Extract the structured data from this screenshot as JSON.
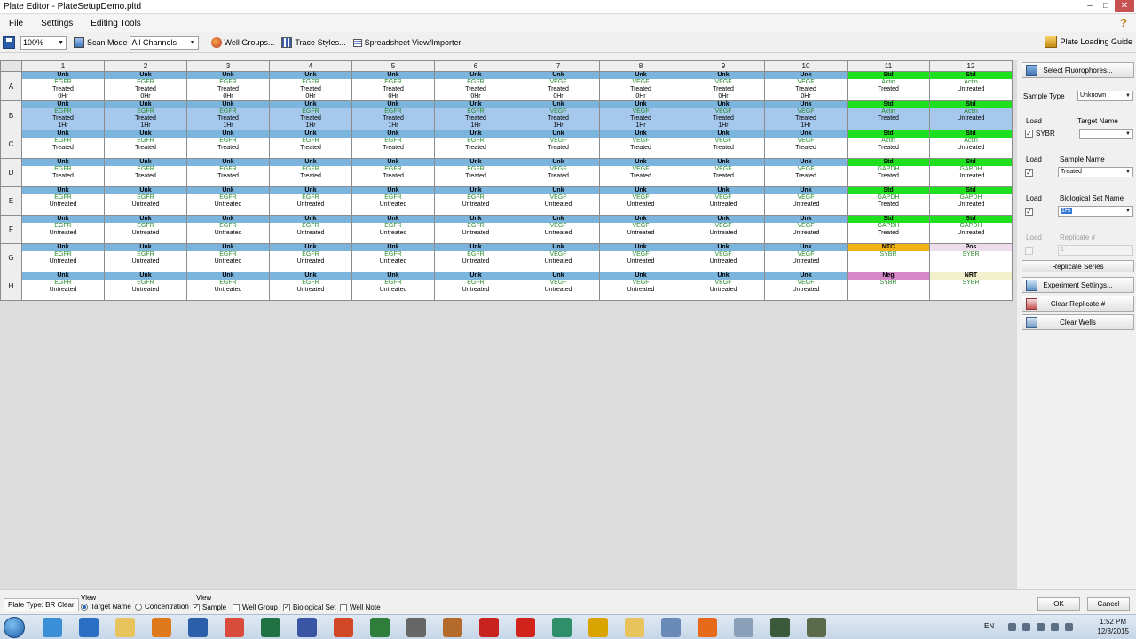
{
  "window": {
    "title": "Plate Editor - PlateSetupDemo.pltd"
  },
  "menu": [
    "File",
    "Settings",
    "Editing Tools"
  ],
  "toolbar": {
    "zoom": "100%",
    "scan_mode_label": "Scan Mode",
    "scan_mode_value": "All Channels",
    "well_groups": "Well Groups...",
    "trace_styles": "Trace Styles...",
    "spreadsheet": "Spreadsheet View/Importer",
    "plate_guide": "Plate Loading Guide"
  },
  "plate": {
    "columns": [
      "1",
      "2",
      "3",
      "4",
      "5",
      "6",
      "7",
      "8",
      "9",
      "10",
      "11",
      "12"
    ],
    "rows": [
      {
        "label": "A",
        "selected": false,
        "wells": [
          {
            "type": "Unk",
            "target": "EGFR",
            "lines": [
              "Treated",
              "0Hr"
            ]
          },
          {
            "type": "Unk",
            "target": "EGFR",
            "lines": [
              "Treated",
              "0Hr"
            ]
          },
          {
            "type": "Unk",
            "target": "EGFR",
            "lines": [
              "Treated",
              "0Hr"
            ]
          },
          {
            "type": "Unk",
            "target": "EGFR",
            "lines": [
              "Treated",
              "0Hr"
            ]
          },
          {
            "type": "Unk",
            "target": "EGFR",
            "lines": [
              "Treated",
              "0Hr"
            ]
          },
          {
            "type": "Unk",
            "target": "EGFR",
            "lines": [
              "Treated",
              "0Hr"
            ]
          },
          {
            "type": "Unk",
            "target": "VEGF",
            "lines": [
              "Treated",
              "0Hr"
            ]
          },
          {
            "type": "Unk",
            "target": "VEGF",
            "lines": [
              "Treated",
              "0Hr"
            ]
          },
          {
            "type": "Unk",
            "target": "VEGF",
            "lines": [
              "Treated",
              "0Hr"
            ]
          },
          {
            "type": "Unk",
            "target": "VEGF",
            "lines": [
              "Treated",
              "0Hr"
            ]
          },
          {
            "type": "Std",
            "target": "Actin",
            "lines": [
              "Treated"
            ]
          },
          {
            "type": "Std",
            "target": "Actin",
            "lines": [
              "Untreated"
            ]
          }
        ]
      },
      {
        "label": "B",
        "selected": true,
        "wells": [
          {
            "type": "Unk",
            "target": "EGFR",
            "lines": [
              "Treated",
              "1Hr"
            ]
          },
          {
            "type": "Unk",
            "target": "EGFR",
            "lines": [
              "Treated",
              "1Hr"
            ]
          },
          {
            "type": "Unk",
            "target": "EGFR",
            "lines": [
              "Treated",
              "1Hr"
            ]
          },
          {
            "type": "Unk",
            "target": "EGFR",
            "lines": [
              "Treated",
              "1Hr"
            ]
          },
          {
            "type": "Unk",
            "target": "EGFR",
            "lines": [
              "Treated",
              "1Hr"
            ]
          },
          {
            "type": "Unk",
            "target": "EGFR",
            "lines": [
              "Treated",
              "1Hr"
            ]
          },
          {
            "type": "Unk",
            "target": "VEGF",
            "lines": [
              "Treated",
              "1Hr"
            ]
          },
          {
            "type": "Unk",
            "target": "VEGF",
            "lines": [
              "Treated",
              "1Hr"
            ]
          },
          {
            "type": "Unk",
            "target": "VEGF",
            "lines": [
              "Treated",
              "1Hr"
            ]
          },
          {
            "type": "Unk",
            "target": "VEGF",
            "lines": [
              "Treated",
              "1Hr"
            ]
          },
          {
            "type": "Std",
            "target": "Actin",
            "lines": [
              "Treated"
            ]
          },
          {
            "type": "Std",
            "target": "Actin",
            "lines": [
              "Untreated"
            ]
          }
        ]
      },
      {
        "label": "C",
        "selected": false,
        "wells": [
          {
            "type": "Unk",
            "target": "EGFR",
            "lines": [
              "Treated"
            ]
          },
          {
            "type": "Unk",
            "target": "EGFR",
            "lines": [
              "Treated"
            ]
          },
          {
            "type": "Unk",
            "target": "EGFR",
            "lines": [
              "Treated"
            ]
          },
          {
            "type": "Unk",
            "target": "EGFR",
            "lines": [
              "Treated"
            ]
          },
          {
            "type": "Unk",
            "target": "EGFR",
            "lines": [
              "Treated"
            ]
          },
          {
            "type": "Unk",
            "target": "EGFR",
            "lines": [
              "Treated"
            ]
          },
          {
            "type": "Unk",
            "target": "VEGF",
            "lines": [
              "Treated"
            ]
          },
          {
            "type": "Unk",
            "target": "VEGF",
            "lines": [
              "Treated"
            ]
          },
          {
            "type": "Unk",
            "target": "VEGF",
            "lines": [
              "Treated"
            ]
          },
          {
            "type": "Unk",
            "target": "VEGF",
            "lines": [
              "Treated"
            ]
          },
          {
            "type": "Std",
            "target": "Actin",
            "lines": [
              "Treated"
            ]
          },
          {
            "type": "Std",
            "target": "Actin",
            "lines": [
              "Untreated"
            ]
          }
        ]
      },
      {
        "label": "D",
        "selected": false,
        "wells": [
          {
            "type": "Unk",
            "target": "EGFR",
            "lines": [
              "Treated"
            ]
          },
          {
            "type": "Unk",
            "target": "EGFR",
            "lines": [
              "Treated"
            ]
          },
          {
            "type": "Unk",
            "target": "EGFR",
            "lines": [
              "Treated"
            ]
          },
          {
            "type": "Unk",
            "target": "EGFR",
            "lines": [
              "Treated"
            ]
          },
          {
            "type": "Unk",
            "target": "EGFR",
            "lines": [
              "Treated"
            ]
          },
          {
            "type": "Unk",
            "target": "EGFR",
            "lines": [
              "Treated"
            ]
          },
          {
            "type": "Unk",
            "target": "VEGF",
            "lines": [
              "Treated"
            ]
          },
          {
            "type": "Unk",
            "target": "VEGF",
            "lines": [
              "Treated"
            ]
          },
          {
            "type": "Unk",
            "target": "VEGF",
            "lines": [
              "Treated"
            ]
          },
          {
            "type": "Unk",
            "target": "VEGF",
            "lines": [
              "Treated"
            ]
          },
          {
            "type": "Std",
            "target": "GAPDH",
            "lines": [
              "Treated"
            ]
          },
          {
            "type": "Std",
            "target": "GAPDH",
            "lines": [
              "Untreated"
            ]
          }
        ]
      },
      {
        "label": "E",
        "selected": false,
        "wells": [
          {
            "type": "Unk",
            "target": "EGFR",
            "lines": [
              "Untreated"
            ]
          },
          {
            "type": "Unk",
            "target": "EGFR",
            "lines": [
              "Untreated"
            ]
          },
          {
            "type": "Unk",
            "target": "EGFR",
            "lines": [
              "Untreated"
            ]
          },
          {
            "type": "Unk",
            "target": "EGFR",
            "lines": [
              "Untreated"
            ]
          },
          {
            "type": "Unk",
            "target": "EGFR",
            "lines": [
              "Untreated"
            ]
          },
          {
            "type": "Unk",
            "target": "EGFR",
            "lines": [
              "Untreated"
            ]
          },
          {
            "type": "Unk",
            "target": "VEGF",
            "lines": [
              "Untreated"
            ]
          },
          {
            "type": "Unk",
            "target": "VEGF",
            "lines": [
              "Untreated"
            ]
          },
          {
            "type": "Unk",
            "target": "VEGF",
            "lines": [
              "Untreated"
            ]
          },
          {
            "type": "Unk",
            "target": "VEGF",
            "lines": [
              "Untreated"
            ]
          },
          {
            "type": "Std",
            "target": "GAPDH",
            "lines": [
              "Treated"
            ]
          },
          {
            "type": "Std",
            "target": "GAPDH",
            "lines": [
              "Untreated"
            ]
          }
        ]
      },
      {
        "label": "F",
        "selected": false,
        "wells": [
          {
            "type": "Unk",
            "target": "EGFR",
            "lines": [
              "Untreated"
            ]
          },
          {
            "type": "Unk",
            "target": "EGFR",
            "lines": [
              "Untreated"
            ]
          },
          {
            "type": "Unk",
            "target": "EGFR",
            "lines": [
              "Untreated"
            ]
          },
          {
            "type": "Unk",
            "target": "EGFR",
            "lines": [
              "Untreated"
            ]
          },
          {
            "type": "Unk",
            "target": "EGFR",
            "lines": [
              "Untreated"
            ]
          },
          {
            "type": "Unk",
            "target": "EGFR",
            "lines": [
              "Untreated"
            ]
          },
          {
            "type": "Unk",
            "target": "VEGF",
            "lines": [
              "Untreated"
            ]
          },
          {
            "type": "Unk",
            "target": "VEGF",
            "lines": [
              "Untreated"
            ]
          },
          {
            "type": "Unk",
            "target": "VEGF",
            "lines": [
              "Untreated"
            ]
          },
          {
            "type": "Unk",
            "target": "VEGF",
            "lines": [
              "Untreated"
            ]
          },
          {
            "type": "Std",
            "target": "GAPDH",
            "lines": [
              "Treated"
            ]
          },
          {
            "type": "Std",
            "target": "GAPDH",
            "lines": [
              "Untreated"
            ]
          }
        ]
      },
      {
        "label": "G",
        "selected": false,
        "wells": [
          {
            "type": "Unk",
            "target": "EGFR",
            "lines": [
              "Untreated"
            ]
          },
          {
            "type": "Unk",
            "target": "EGFR",
            "lines": [
              "Untreated"
            ]
          },
          {
            "type": "Unk",
            "target": "EGFR",
            "lines": [
              "Untreated"
            ]
          },
          {
            "type": "Unk",
            "target": "EGFR",
            "lines": [
              "Untreated"
            ]
          },
          {
            "type": "Unk",
            "target": "EGFR",
            "lines": [
              "Untreated"
            ]
          },
          {
            "type": "Unk",
            "target": "EGFR",
            "lines": [
              "Untreated"
            ]
          },
          {
            "type": "Unk",
            "target": "VEGF",
            "lines": [
              "Untreated"
            ]
          },
          {
            "type": "Unk",
            "target": "VEGF",
            "lines": [
              "Untreated"
            ]
          },
          {
            "type": "Unk",
            "target": "VEGF",
            "lines": [
              "Untreated"
            ]
          },
          {
            "type": "Unk",
            "target": "VEGF",
            "lines": [
              "Untreated"
            ]
          },
          {
            "type": "NTC",
            "target": "SYBR",
            "lines": []
          },
          {
            "type": "Pos",
            "target": "SYBR",
            "lines": []
          }
        ]
      },
      {
        "label": "H",
        "selected": false,
        "wells": [
          {
            "type": "Unk",
            "target": "EGFR",
            "lines": [
              "Untreated"
            ]
          },
          {
            "type": "Unk",
            "target": "EGFR",
            "lines": [
              "Untreated"
            ]
          },
          {
            "type": "Unk",
            "target": "EGFR",
            "lines": [
              "Untreated"
            ]
          },
          {
            "type": "Unk",
            "target": "EGFR",
            "lines": [
              "Untreated"
            ]
          },
          {
            "type": "Unk",
            "target": "EGFR",
            "lines": [
              "Untreated"
            ]
          },
          {
            "type": "Unk",
            "target": "EGFR",
            "lines": [
              "Untreated"
            ]
          },
          {
            "type": "Unk",
            "target": "VEGF",
            "lines": [
              "Untreated"
            ]
          },
          {
            "type": "Unk",
            "target": "VEGF",
            "lines": [
              "Untreated"
            ]
          },
          {
            "type": "Unk",
            "target": "VEGF",
            "lines": [
              "Untreated"
            ]
          },
          {
            "type": "Unk",
            "target": "VEGF",
            "lines": [
              "Untreated"
            ]
          },
          {
            "type": "Neg",
            "target": "SYBR",
            "lines": []
          },
          {
            "type": "NRT",
            "target": "SYBR",
            "lines": []
          }
        ]
      }
    ]
  },
  "panel": {
    "select_fluorophores": "Select Fluorophores...",
    "sample_type_label": "Sample Type",
    "sample_type_value": "Unknown",
    "load_label": "Load",
    "target_name_label": "Target Name",
    "fluor_name": "SYBR",
    "sample_name_label": "Sample Name",
    "sample_name_value": "Treated",
    "bio_set_label": "Biological Set Name",
    "bio_set_value": "1Hr",
    "replicate_label": "Replicate #",
    "replicate_value": "1",
    "replicate_series": "Replicate Series",
    "experiment_settings": "Experiment Settings...",
    "clear_replicate": "Clear Replicate #",
    "clear_wells": "Clear Wells"
  },
  "bottom": {
    "plate_type": "Plate Type: BR Clear",
    "view_label": "View",
    "target_name": "Target Name",
    "concentration": "Concentration",
    "sample": "Sample",
    "well_group": "Well Group",
    "biological_set": "Biological Set",
    "well_note": "Well Note",
    "ok": "OK",
    "cancel": "Cancel"
  },
  "taskbar": {
    "lang": "EN",
    "time": "1:52 PM",
    "date": "12/3/2015"
  },
  "colors": {
    "unk": "#7bb4dc",
    "std": "#1ee01e",
    "ntc": "#f0b214",
    "pos": "#ecdcec",
    "neg": "#d488c8",
    "nrt": "#f2f0cc",
    "selected_row": "#a6c8ec",
    "target_text": "#2a8a2a"
  }
}
